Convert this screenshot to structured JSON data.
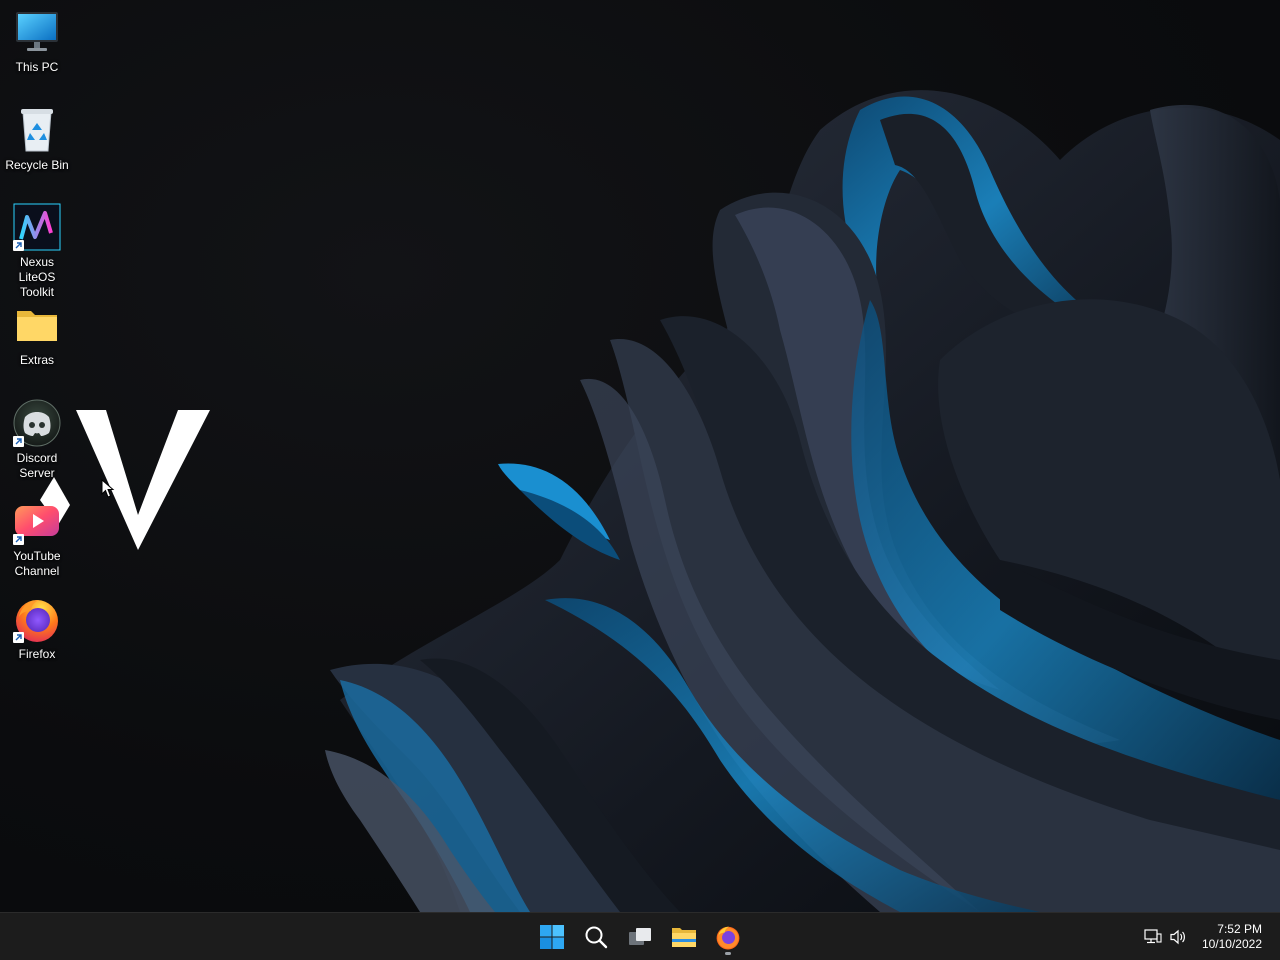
{
  "desktop": {
    "icons": [
      {
        "label": "This PC",
        "icon": "computer-monitor-icon"
      },
      {
        "label": "Recycle Bin",
        "icon": "recycle-bin-icon"
      },
      {
        "label": "Nexus LiteOS\nToolkit",
        "icon": "nexus-liteos-logo-icon"
      },
      {
        "label": "Extras",
        "icon": "folder-icon"
      },
      {
        "label": "Discord\nServer",
        "icon": "discord-icon"
      },
      {
        "label": "YouTube\nChannel",
        "icon": "youtube-icon"
      },
      {
        "label": "Firefox",
        "icon": "firefox-icon"
      }
    ]
  },
  "taskbar": {
    "buttons": [
      {
        "name": "start",
        "icon": "windows-logo-icon"
      },
      {
        "name": "search",
        "icon": "search-icon"
      },
      {
        "name": "task-view",
        "icon": "task-view-icon"
      },
      {
        "name": "file-explorer",
        "icon": "folder-icon"
      },
      {
        "name": "firefox",
        "icon": "firefox-icon",
        "running": true
      }
    ],
    "tray": {
      "icons": [
        "network-icon",
        "volume-icon"
      ],
      "time": "7:52 PM",
      "date": "10/10/2022"
    }
  },
  "colors": {
    "taskbar_bg": "#1c1c1c",
    "accent_blue": "#0e8fd6",
    "wallpaper_bg": "#0c0d0f"
  }
}
